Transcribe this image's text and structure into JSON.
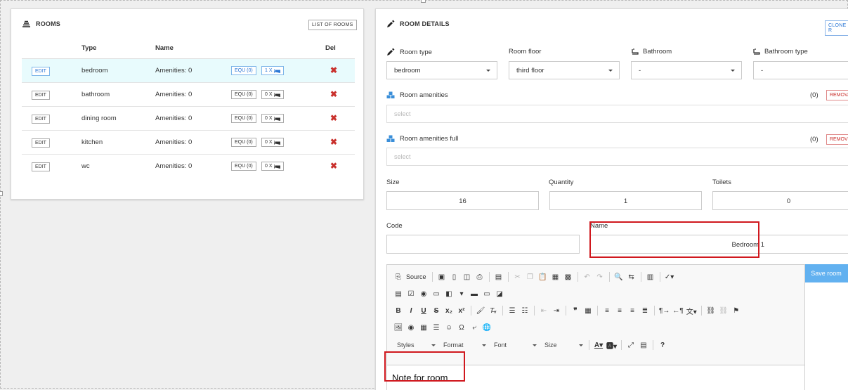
{
  "rooms_panel": {
    "title": "ROOMS",
    "list_button": "LIST OF ROOMS",
    "headers": {
      "type": "Type",
      "name": "Name",
      "del": "Del"
    },
    "rows": [
      {
        "edit": "EDIT",
        "type": "bedroom",
        "amenities": "Amenities: 0",
        "equ": "EQU (0)",
        "beds": "1 X",
        "selected": true
      },
      {
        "edit": "EDIT",
        "type": "bathroom",
        "amenities": "Amenities: 0",
        "equ": "EQU (0)",
        "beds": "0 X",
        "selected": false
      },
      {
        "edit": "EDIT",
        "type": "dining room",
        "amenities": "Amenities: 0",
        "equ": "EQU (0)",
        "beds": "0 X",
        "selected": false
      },
      {
        "edit": "EDIT",
        "type": "kitchen",
        "amenities": "Amenities: 0",
        "equ": "EQU (0)",
        "beds": "0 X",
        "selected": false
      },
      {
        "edit": "EDIT",
        "type": "wc",
        "amenities": "Amenities: 0",
        "equ": "EQU (0)",
        "beds": "0 X",
        "selected": false
      }
    ],
    "del_symbol": "✖"
  },
  "details_panel": {
    "title": "ROOM DETAILS",
    "clone_button": "CLONE R",
    "room_type": {
      "label": "Room type",
      "value": "bedroom"
    },
    "room_floor": {
      "label": "Room floor",
      "value": "third floor"
    },
    "bathroom": {
      "label": "Bathroom",
      "value": "-"
    },
    "bathroom_type": {
      "label": "Bathroom type",
      "value": "-"
    },
    "amenities": {
      "label": "Room amenities",
      "count": "(0)",
      "remove": "REMOVA",
      "placeholder": "select"
    },
    "amenities_full": {
      "label": "Room amenities full",
      "count": "(0)",
      "remove": "REMOVE",
      "placeholder": "select"
    },
    "size": {
      "label": "Size",
      "value": "16"
    },
    "quantity": {
      "label": "Quantity",
      "value": "1"
    },
    "toilets": {
      "label": "Toilets",
      "value": "0"
    },
    "code": {
      "label": "Code",
      "value": ""
    },
    "name": {
      "label": "Name",
      "value": "Bedroom 1"
    },
    "save_button": "Save room",
    "editor": {
      "source_label": "Source",
      "styles_label": "Styles",
      "format_label": "Format",
      "font_label": "Font",
      "size_label": "Size",
      "content": "Note for room"
    }
  },
  "colors": {
    "accent_blue": "#2b77d6",
    "save_button": "#62b1f0",
    "delete_red": "#c9302c",
    "highlight_red": "#d0181e",
    "selected_row": "#e8fbfd"
  }
}
